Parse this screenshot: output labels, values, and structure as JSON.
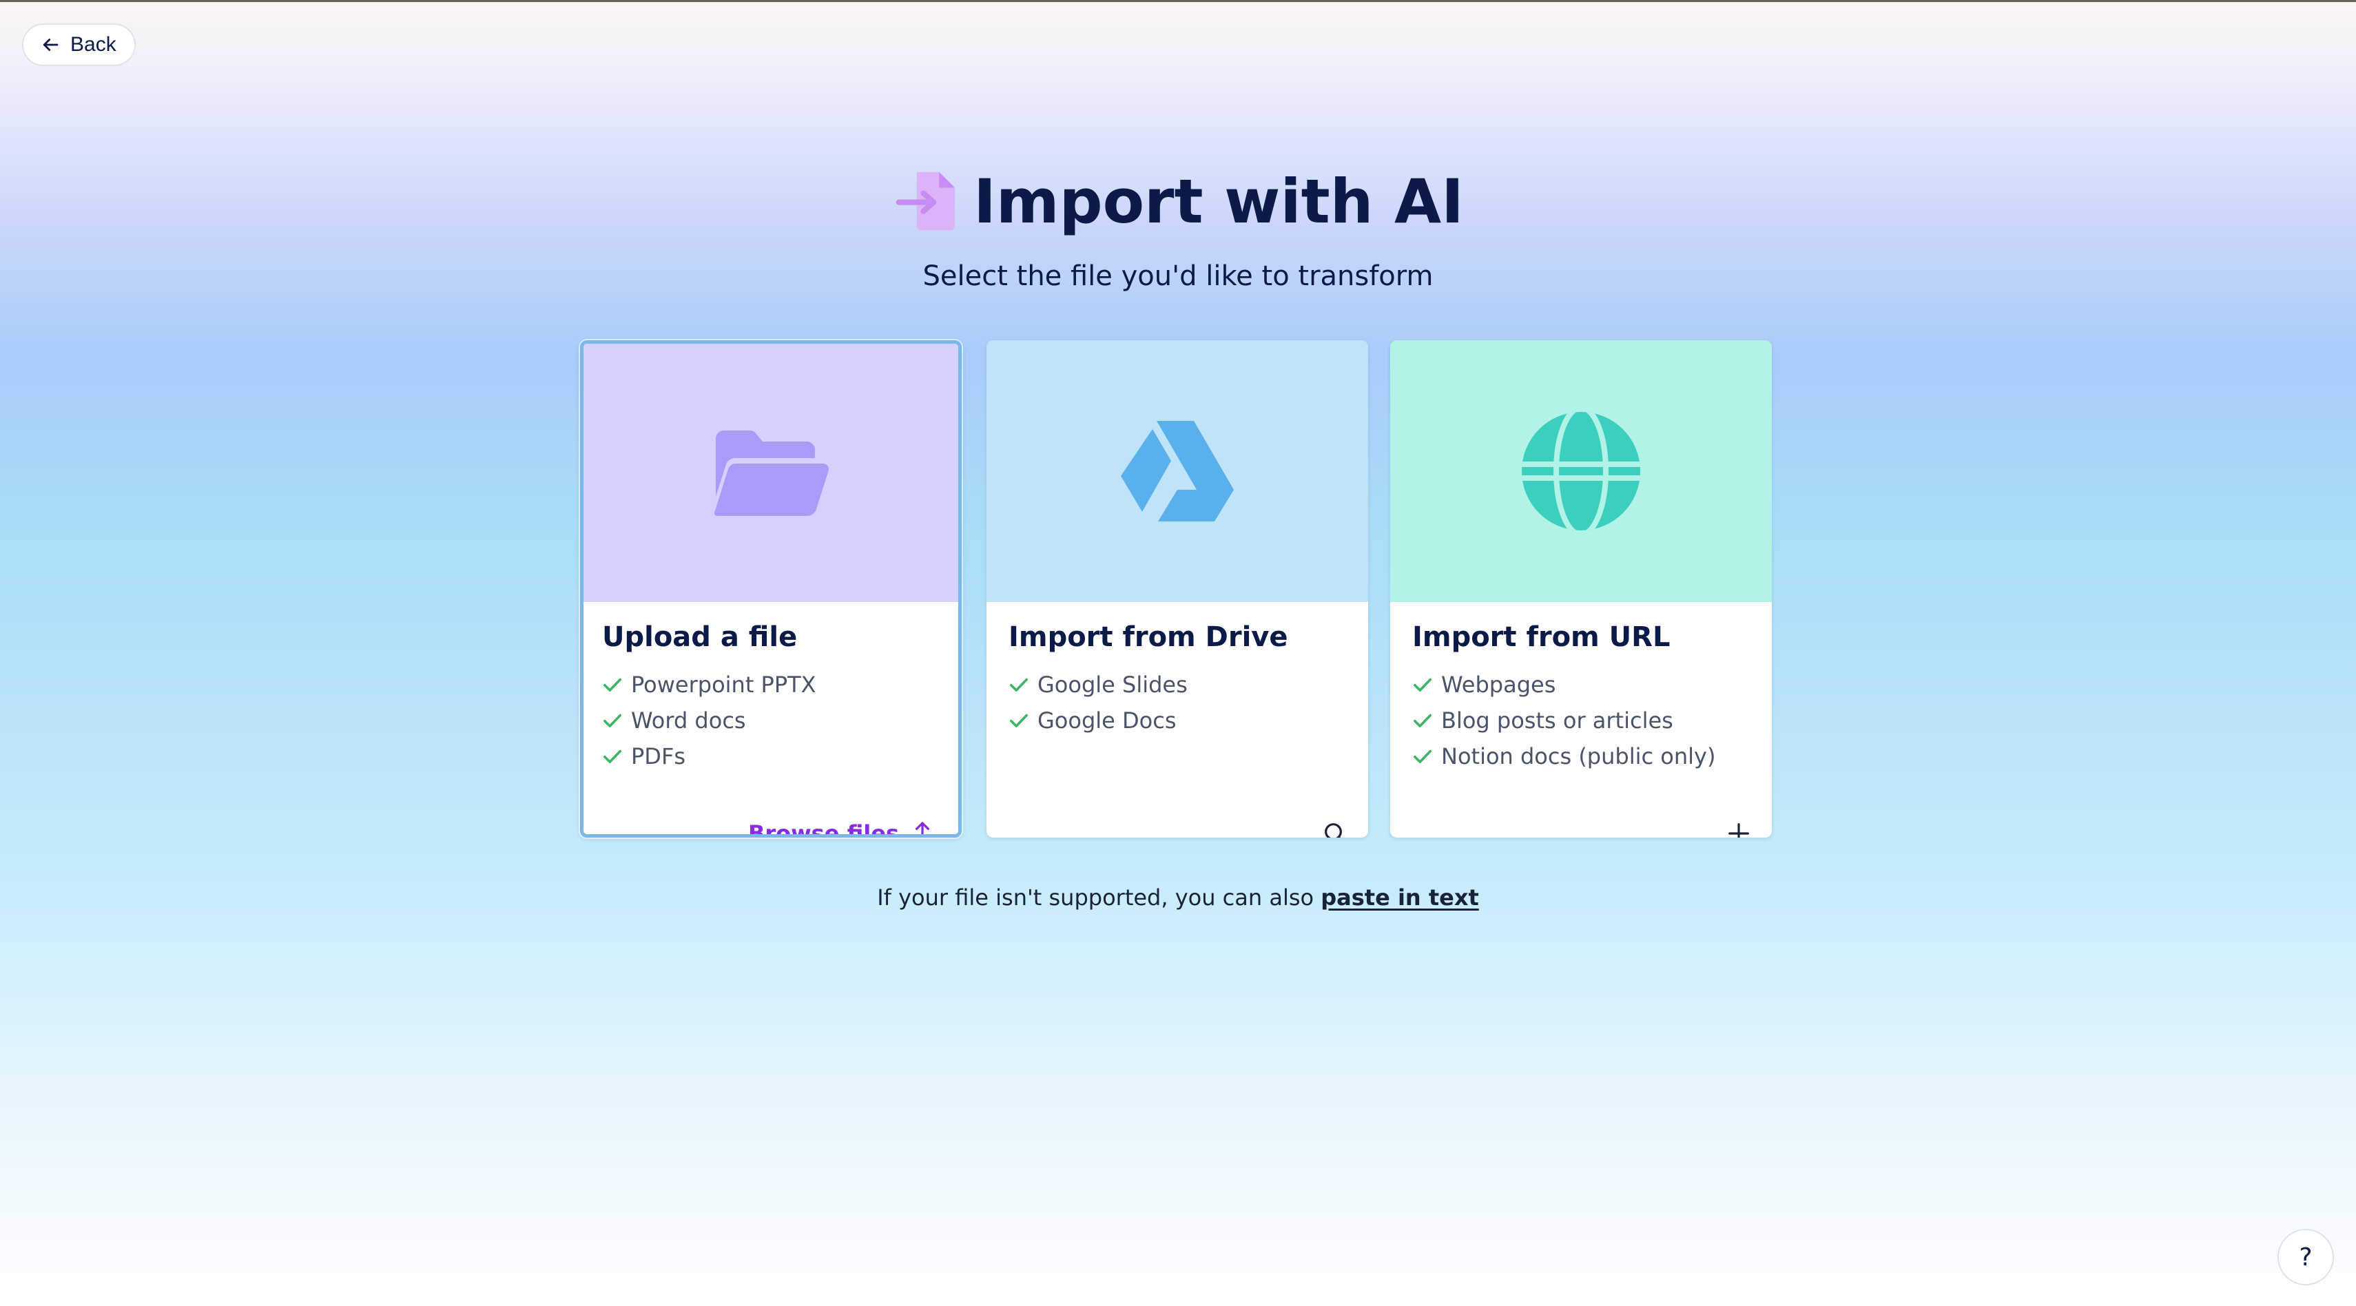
{
  "header": {
    "back_label": "Back"
  },
  "page": {
    "title": "Import with AI",
    "subtitle": "Select the file you'd like to transform"
  },
  "cards": [
    {
      "title": "Upload a file",
      "icon": "folder-open-icon",
      "hero_color": "#d6d0fd",
      "icon_color": "#a79cf7",
      "selected": true,
      "features": [
        "Powerpoint PPTX",
        "Word docs",
        "PDFs"
      ],
      "action_label": "Browse files",
      "action_icon": "upload-icon"
    },
    {
      "title": "Import from Drive",
      "icon": "google-drive-icon",
      "hero_color": "#bfe3f8",
      "icon_color": "#5ab0ea",
      "selected": false,
      "features": [
        "Google Slides",
        "Google Docs"
      ],
      "action_icon": "search-icon"
    },
    {
      "title": "Import from URL",
      "icon": "globe-icon",
      "hero_color": "#b2f3e7",
      "icon_color": "#3dcfbd",
      "selected": false,
      "features": [
        "Webpages",
        "Blog posts or articles",
        "Notion docs (public only)"
      ],
      "action_icon": "plus-icon"
    }
  ],
  "footer": {
    "note_prefix": "If your file isn't supported, you can also",
    "link_label": "paste in text"
  },
  "help": {
    "label": "?"
  },
  "colors": {
    "check": "#3bb563",
    "accent": "#8a2be2",
    "text": "#0b1a47"
  }
}
